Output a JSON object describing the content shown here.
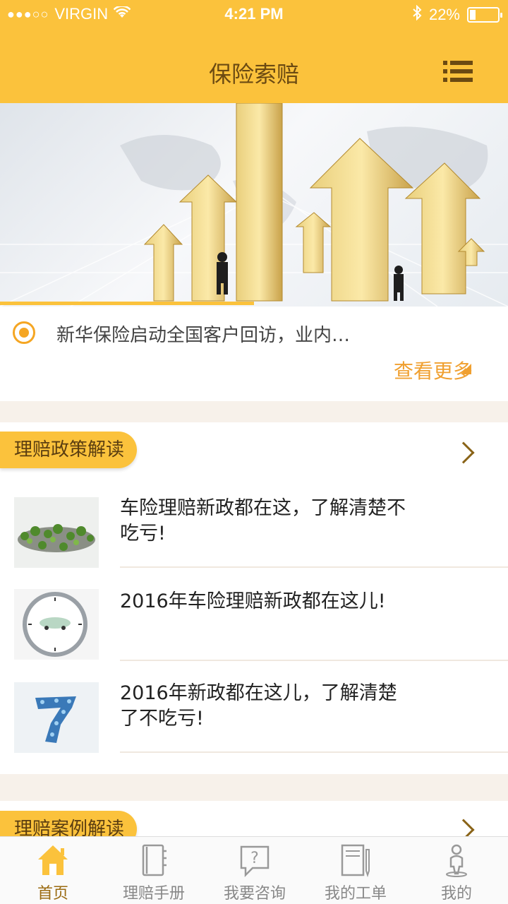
{
  "status_bar": {
    "carrier": "VIRGIN",
    "signal": "●●●○○",
    "time": "4:21 PM",
    "battery": "22%",
    "battery_level": 0.22
  },
  "header": {
    "title": "保险索赔"
  },
  "news": {
    "headline": "新华保险启动全国客户回访，业内…",
    "more_label": "查看更多"
  },
  "sections": [
    {
      "title": "理赔政策解读",
      "articles": [
        {
          "title_line1": "车险理赔新政都在这，了解清楚不",
          "title_line2": "吃亏!"
        },
        {
          "title_line1": "2016年车险理赔新政都在这儿!",
          "title_line2": ""
        },
        {
          "title_line1": "2016年新政都在这儿，了解清楚",
          "title_line2": "了不吃亏!"
        }
      ]
    },
    {
      "title": "理赔案例解读",
      "articles": []
    }
  ],
  "tabs": [
    {
      "label": "首页",
      "icon": "home-icon",
      "active": true
    },
    {
      "label": "理赔手册",
      "icon": "notebook-icon",
      "active": false
    },
    {
      "label": "我要咨询",
      "icon": "question-chat-icon",
      "active": false
    },
    {
      "label": "我的工单",
      "icon": "document-pen-icon",
      "active": false
    },
    {
      "label": "我的",
      "icon": "person-icon",
      "active": false
    }
  ],
  "colors": {
    "accent": "#fbc23c",
    "link": "#f0a030",
    "title_text": "#6b4a12"
  }
}
